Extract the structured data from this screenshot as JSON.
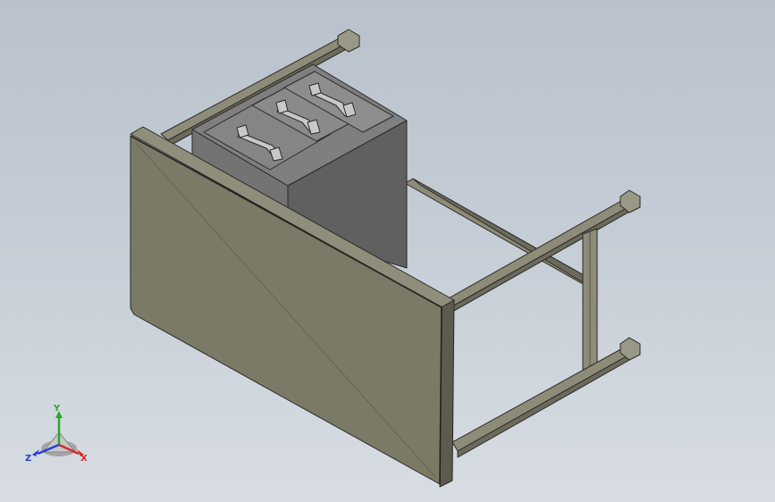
{
  "viewport": {
    "background_top": "#b9c2cc",
    "background_bottom": "#d8dde3"
  },
  "model": {
    "name": "desk-with-drawer-unit",
    "tabletop_color": "#7b7a66",
    "frame_color": "#8e8c78",
    "drawer_color": "#808080",
    "edge_color": "#2a2a2a"
  },
  "triad": {
    "x_label": "X",
    "y_label": "Y",
    "z_label": "Z",
    "x_color": "#d22a2a",
    "y_color": "#2aa72a",
    "z_color": "#2a3ed2"
  }
}
